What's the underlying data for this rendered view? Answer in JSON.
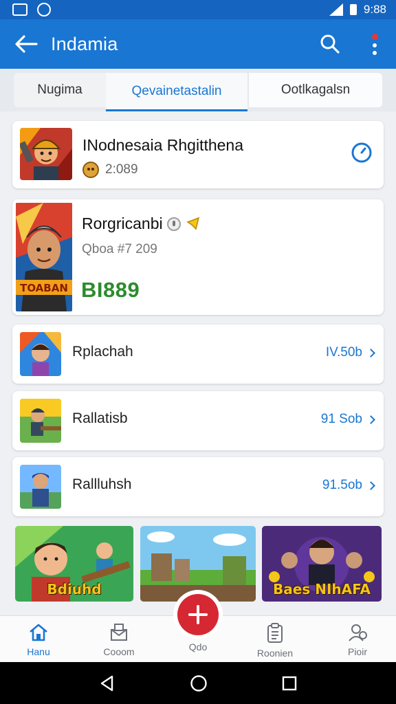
{
  "status_bar": {
    "time": "9:88"
  },
  "app_bar": {
    "title": "Indamia"
  },
  "tabs": [
    {
      "label": "Nugima",
      "active": false
    },
    {
      "label": "Qevainetastalin",
      "active": true
    },
    {
      "label": "Ootlkagalsn",
      "active": false
    }
  ],
  "featured": {
    "title": "INodnesaia Rhgitthena",
    "meta": "2:089"
  },
  "highlight": {
    "title": "Rorgricanbi",
    "subtitle": "Qboa #7  209",
    "price": "BI889"
  },
  "list": [
    {
      "label": "Rplachah",
      "value": "IV.50b"
    },
    {
      "label": "Rallatisb",
      "value": "91 Sob"
    },
    {
      "label": "Rallluhsh",
      "value": "91.5ob"
    }
  ],
  "banners": [
    {
      "caption": "Bdiuhd"
    },
    {
      "caption": ""
    },
    {
      "caption": "Baes NIhAFA"
    }
  ],
  "bottom_nav": [
    {
      "label": "Hanu",
      "icon": "home-icon",
      "active": true
    },
    {
      "label": "Cooom",
      "icon": "inbox-icon",
      "active": false
    },
    {
      "label": "Qdo",
      "icon": "add-icon",
      "active": false
    },
    {
      "label": "Roonien",
      "icon": "clipboard-icon",
      "active": false
    },
    {
      "label": "Pioir",
      "icon": "profile-icon",
      "active": false
    }
  ],
  "colors": {
    "primary": "#1976d2",
    "status_bar": "#1565c0",
    "fab": "#d62833",
    "price": "#2e8b2e"
  }
}
